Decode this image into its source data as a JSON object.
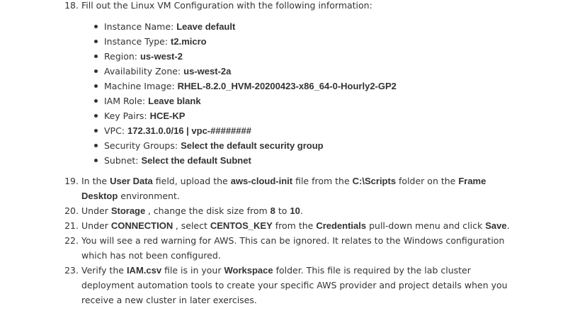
{
  "step18": {
    "num": "18",
    "text": "Fill out the Linux VM Configuration with the following information:",
    "items": [
      {
        "label": "Instance Name: ",
        "value": "Leave default"
      },
      {
        "label": "Instance Type: ",
        "value": "t2.micro"
      },
      {
        "label": "Region: ",
        "value": "us-west-2"
      },
      {
        "label": "Availability Zone: ",
        "value": "us-west-2a"
      },
      {
        "label": "Machine Image: ",
        "value": "RHEL-8.2.0_HVM-20200423-x86_64-0-Hourly2-GP2"
      },
      {
        "label": "IAM Role: ",
        "value": "Leave blank"
      },
      {
        "label": "Key Pairs: ",
        "value": "HCE-KP"
      },
      {
        "label": "VPC: ",
        "value": "172.31.0.0/16 | vpc-########"
      },
      {
        "label": "Security Groups: ",
        "value": "Select the default security group"
      },
      {
        "label": "Subnet: ",
        "value": "Select the default Subnet"
      }
    ]
  },
  "step19": {
    "num": "19",
    "t1": "In the ",
    "b1": "User Data",
    "t2": " field, upload the ",
    "b2": "aws-cloud-init",
    "t3": " file from the ",
    "b3": "C:\\Scripts",
    "t4": " folder on the ",
    "b4": "Frame",
    "b5": "Desktop",
    "t5": " environment."
  },
  "step20": {
    "num": "20",
    "t1": "Under ",
    "b1": "Storage ",
    "t2": ", change the disk size from ",
    "b2": "8",
    "t3": " to ",
    "b3": "10",
    "t4": "."
  },
  "step21": {
    "num": "21",
    "t1": "Under ",
    "b1": "CONNECTION ",
    "t2": ", select ",
    "b2": "CENTOS_KEY",
    "t3": " from the ",
    "b3": "Credentials",
    "t4": " pull-down menu and click ",
    "b4": "Save",
    "t5": "."
  },
  "step22": {
    "num": "22",
    "line1": "You will see a red warning for AWS. This can be ignored. It relates to the Windows configuration",
    "line2": "which has not been configured."
  },
  "step23": {
    "num": "23",
    "t1": "Verify the ",
    "b1": "IAM.csv",
    "t2": " file is in your ",
    "b2": "Workspace",
    "t3": " folder. This file is required by the lab cluster",
    "line2": "deployment automation tools to create your specific AWS provider and project details when you",
    "line3": "receive a new cluster in later exercises."
  }
}
